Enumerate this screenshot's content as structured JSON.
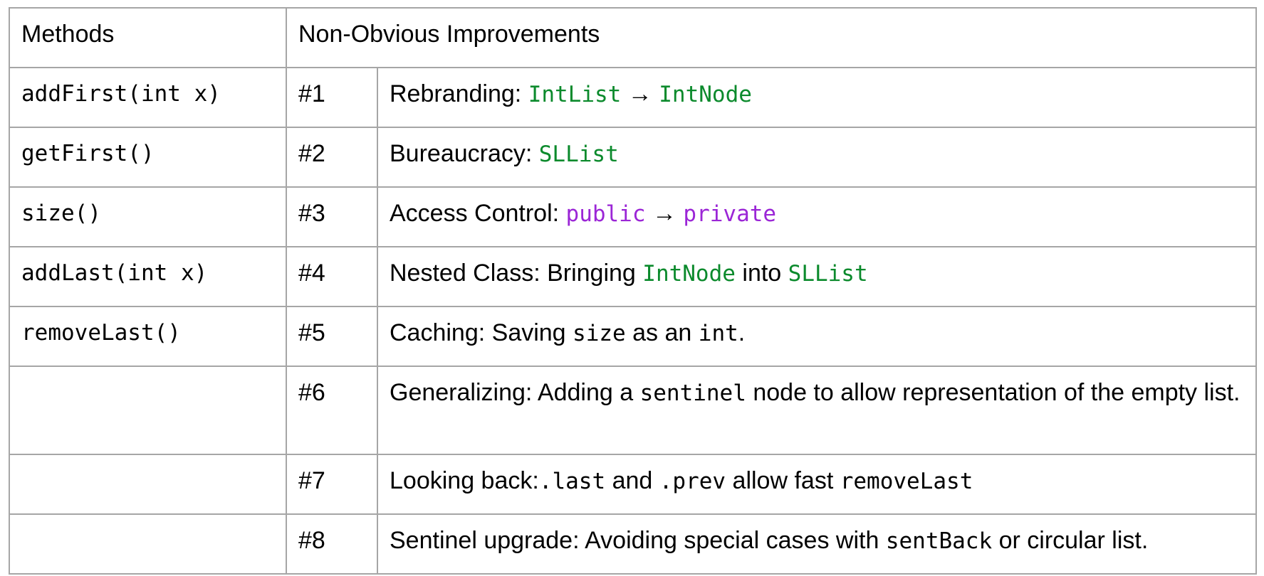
{
  "header": {
    "methods_label": "Methods",
    "improvements_label": "Non-Obvious Improvements"
  },
  "colors": {
    "class_name": "#0b8a2c",
    "keyword": "#9b26d6",
    "border": "#a6a6a6"
  },
  "arrow": "→",
  "rows": [
    {
      "method": "addFirst(int x)",
      "num": "#1",
      "parts": {
        "a": "Rebranding: ",
        "b": "IntList",
        "c": " → ",
        "d": "IntNode"
      }
    },
    {
      "method": "getFirst()",
      "num": "#2",
      "parts": {
        "a": "Bureaucracy: ",
        "b": "SLList"
      }
    },
    {
      "method": "size()",
      "num": "#3",
      "parts": {
        "a": "Access Control: ",
        "b": "public",
        "c": " → ",
        "d": "private"
      }
    },
    {
      "method": "addLast(int x)",
      "num": "#4",
      "parts": {
        "a": "Nested Class: Bringing ",
        "b": "IntNode",
        "c": " into ",
        "d": "SLList"
      }
    },
    {
      "method": "removeLast()",
      "num": "#5",
      "parts": {
        "a": "Caching: Saving ",
        "b": "size",
        "c": " as an ",
        "d": "int",
        "e": "."
      }
    },
    {
      "method": "",
      "num": "#6",
      "parts": {
        "a": "Generalizing: Adding a ",
        "b": "sentinel",
        "c": " node to allow representation of the empty list."
      }
    },
    {
      "method": "",
      "num": "#7",
      "parts": {
        "a": "Looking back:",
        "b": ".last",
        "c": " and ",
        "d": ".prev",
        "e": " allow fast ",
        "f": "removeLast"
      }
    },
    {
      "method": "",
      "num": "#8",
      "parts": {
        "a": "Sentinel upgrade: Avoiding special cases with ",
        "b": "sentBack",
        "c": " or circular list."
      }
    }
  ]
}
